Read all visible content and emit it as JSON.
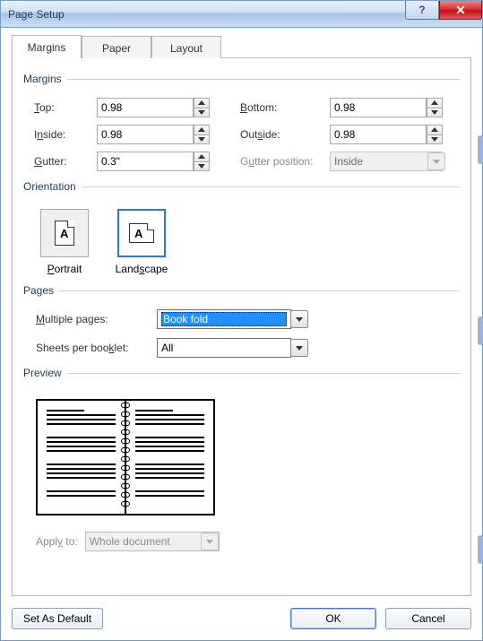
{
  "window": {
    "title": "Page Setup"
  },
  "tabs": {
    "margins": "Margins",
    "paper": "Paper",
    "layout": "Layout"
  },
  "sections": {
    "margins": "Margins",
    "orientation": "Orientation",
    "pages": "Pages",
    "preview": "Preview"
  },
  "margins": {
    "top_label": "Top:",
    "top_value": "0.98",
    "bottom_label": "Bottom:",
    "bottom_value": "0.98",
    "inside_label": "Inside:",
    "inside_value": "0.98",
    "outside_label": "Outside:",
    "outside_value": "0.98",
    "gutter_label": "Gutter:",
    "gutter_value": "0.3\"",
    "gutterpos_label": "Gutter position:",
    "gutterpos_value": "Inside"
  },
  "orientation": {
    "portrait": "Portrait",
    "landscape": "Landscape",
    "selected": "landscape"
  },
  "pages": {
    "multiple_label": "Multiple pages:",
    "multiple_value": "Book fold",
    "sheets_label": "Sheets per booklet:",
    "sheets_value": "All"
  },
  "apply": {
    "label": "Apply to:",
    "value": "Whole document"
  },
  "buttons": {
    "set_default": "Set As Default",
    "ok": "OK",
    "cancel": "Cancel"
  }
}
